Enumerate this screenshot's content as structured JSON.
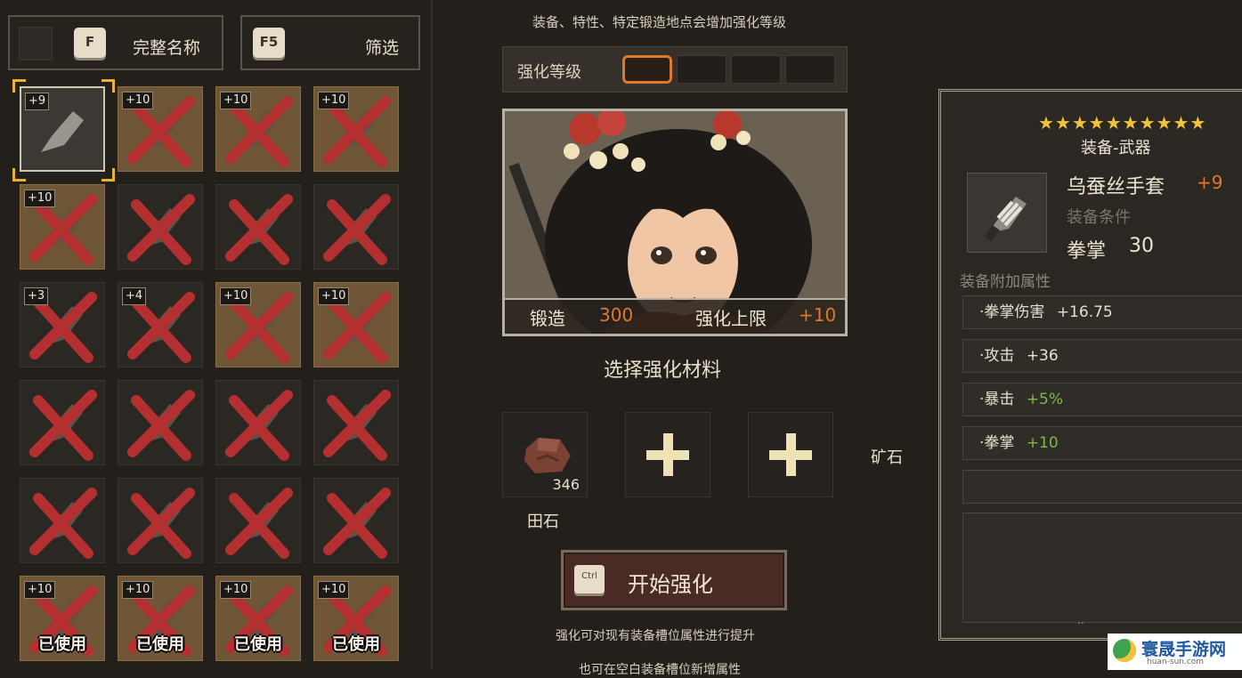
{
  "left": {
    "full_name_key": "F",
    "full_name_label": "完整名称",
    "filter_key": "F5",
    "filter_label": "筛选",
    "slots": [
      {
        "level": "+9",
        "state": "selected",
        "used": ""
      },
      {
        "level": "+10",
        "state": "high",
        "used": ""
      },
      {
        "level": "+10",
        "state": "high",
        "used": ""
      },
      {
        "level": "+10",
        "state": "high",
        "used": ""
      },
      {
        "level": "+10",
        "state": "high",
        "used": ""
      },
      {
        "level": "",
        "state": "normal",
        "used": ""
      },
      {
        "level": "",
        "state": "normal",
        "used": ""
      },
      {
        "level": "",
        "state": "normal",
        "used": ""
      },
      {
        "level": "+3",
        "state": "normal",
        "used": ""
      },
      {
        "level": "+4",
        "state": "normal",
        "used": ""
      },
      {
        "level": "+10",
        "state": "high",
        "used": ""
      },
      {
        "level": "+10",
        "state": "high",
        "used": ""
      },
      {
        "level": "",
        "state": "normal",
        "used": ""
      },
      {
        "level": "",
        "state": "normal",
        "used": ""
      },
      {
        "level": "",
        "state": "normal",
        "used": ""
      },
      {
        "level": "",
        "state": "normal",
        "used": ""
      },
      {
        "level": "",
        "state": "normal",
        "used": ""
      },
      {
        "level": "",
        "state": "normal",
        "used": ""
      },
      {
        "level": "",
        "state": "normal",
        "used": ""
      },
      {
        "level": "",
        "state": "normal",
        "used": ""
      },
      {
        "level": "+10",
        "state": "high",
        "used": "已使用"
      },
      {
        "level": "+10",
        "state": "high",
        "used": "已使用"
      },
      {
        "level": "+10",
        "state": "high",
        "used": "已使用"
      },
      {
        "level": "+10",
        "state": "high",
        "used": "已使用"
      }
    ]
  },
  "center": {
    "top_hint": "装备、特性、特定锻造地点会增加强化等级",
    "level_label": "强化等级",
    "forge_label": "锻造",
    "forge_value": "300",
    "cap_label": "强化上限",
    "cap_value": "+10",
    "select_material": "选择强化材料",
    "material_count": "346",
    "material_name": "田石",
    "ore_label": "矿石",
    "start_key": "Ctrl",
    "start_label": "开始强化",
    "bottom_hint": "强化可对现有装备槽位属性进行提升",
    "bottom_hint2": "也可在空白装备槽位新增属性"
  },
  "right": {
    "stars": "★★★★★★★★★★",
    "category": "装备-武器",
    "item_name": "乌蚕丝手套",
    "item_level": "+9",
    "condition_label": "装备条件",
    "req_skill": "拳掌",
    "req_value": "30",
    "attr_header": "装备附加属性",
    "attrs": [
      {
        "name": "·拳掌伤害",
        "value": "+16.75"
      },
      {
        "name": "·攻击",
        "value": "+36"
      },
      {
        "name": "·暴击",
        "value": "+5%"
      },
      {
        "name": "·拳掌",
        "value": "+10"
      }
    ],
    "footer_dots": ".."
  },
  "watermark": {
    "title": "寰晟手游网",
    "subtitle": "huan-sun.com"
  },
  "colors": {
    "accent_orange": "#e0782a",
    "selection_gold": "#e6b23e",
    "x_red": "#b42f2f",
    "green_value": "#7bbd45"
  }
}
